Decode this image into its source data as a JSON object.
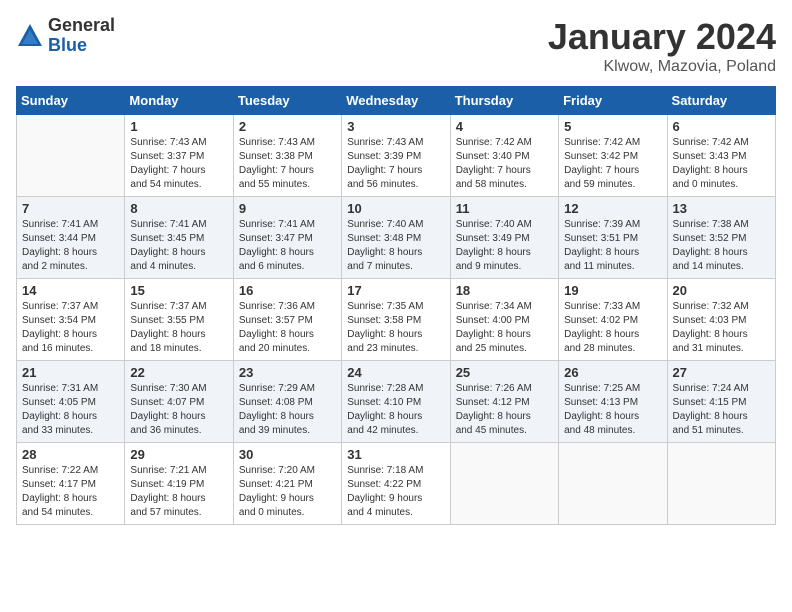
{
  "logo": {
    "general": "General",
    "blue": "Blue"
  },
  "header": {
    "title": "January 2024",
    "subtitle": "Klwow, Mazovia, Poland"
  },
  "weekdays": [
    "Sunday",
    "Monday",
    "Tuesday",
    "Wednesday",
    "Thursday",
    "Friday",
    "Saturday"
  ],
  "weeks": [
    [
      {
        "day": "",
        "info": ""
      },
      {
        "day": "1",
        "info": "Sunrise: 7:43 AM\nSunset: 3:37 PM\nDaylight: 7 hours\nand 54 minutes."
      },
      {
        "day": "2",
        "info": "Sunrise: 7:43 AM\nSunset: 3:38 PM\nDaylight: 7 hours\nand 55 minutes."
      },
      {
        "day": "3",
        "info": "Sunrise: 7:43 AM\nSunset: 3:39 PM\nDaylight: 7 hours\nand 56 minutes."
      },
      {
        "day": "4",
        "info": "Sunrise: 7:42 AM\nSunset: 3:40 PM\nDaylight: 7 hours\nand 58 minutes."
      },
      {
        "day": "5",
        "info": "Sunrise: 7:42 AM\nSunset: 3:42 PM\nDaylight: 7 hours\nand 59 minutes."
      },
      {
        "day": "6",
        "info": "Sunrise: 7:42 AM\nSunset: 3:43 PM\nDaylight: 8 hours\nand 0 minutes."
      }
    ],
    [
      {
        "day": "7",
        "info": "Sunrise: 7:41 AM\nSunset: 3:44 PM\nDaylight: 8 hours\nand 2 minutes."
      },
      {
        "day": "8",
        "info": "Sunrise: 7:41 AM\nSunset: 3:45 PM\nDaylight: 8 hours\nand 4 minutes."
      },
      {
        "day": "9",
        "info": "Sunrise: 7:41 AM\nSunset: 3:47 PM\nDaylight: 8 hours\nand 6 minutes."
      },
      {
        "day": "10",
        "info": "Sunrise: 7:40 AM\nSunset: 3:48 PM\nDaylight: 8 hours\nand 7 minutes."
      },
      {
        "day": "11",
        "info": "Sunrise: 7:40 AM\nSunset: 3:49 PM\nDaylight: 8 hours\nand 9 minutes."
      },
      {
        "day": "12",
        "info": "Sunrise: 7:39 AM\nSunset: 3:51 PM\nDaylight: 8 hours\nand 11 minutes."
      },
      {
        "day": "13",
        "info": "Sunrise: 7:38 AM\nSunset: 3:52 PM\nDaylight: 8 hours\nand 14 minutes."
      }
    ],
    [
      {
        "day": "14",
        "info": "Sunrise: 7:37 AM\nSunset: 3:54 PM\nDaylight: 8 hours\nand 16 minutes."
      },
      {
        "day": "15",
        "info": "Sunrise: 7:37 AM\nSunset: 3:55 PM\nDaylight: 8 hours\nand 18 minutes."
      },
      {
        "day": "16",
        "info": "Sunrise: 7:36 AM\nSunset: 3:57 PM\nDaylight: 8 hours\nand 20 minutes."
      },
      {
        "day": "17",
        "info": "Sunrise: 7:35 AM\nSunset: 3:58 PM\nDaylight: 8 hours\nand 23 minutes."
      },
      {
        "day": "18",
        "info": "Sunrise: 7:34 AM\nSunset: 4:00 PM\nDaylight: 8 hours\nand 25 minutes."
      },
      {
        "day": "19",
        "info": "Sunrise: 7:33 AM\nSunset: 4:02 PM\nDaylight: 8 hours\nand 28 minutes."
      },
      {
        "day": "20",
        "info": "Sunrise: 7:32 AM\nSunset: 4:03 PM\nDaylight: 8 hours\nand 31 minutes."
      }
    ],
    [
      {
        "day": "21",
        "info": "Sunrise: 7:31 AM\nSunset: 4:05 PM\nDaylight: 8 hours\nand 33 minutes."
      },
      {
        "day": "22",
        "info": "Sunrise: 7:30 AM\nSunset: 4:07 PM\nDaylight: 8 hours\nand 36 minutes."
      },
      {
        "day": "23",
        "info": "Sunrise: 7:29 AM\nSunset: 4:08 PM\nDaylight: 8 hours\nand 39 minutes."
      },
      {
        "day": "24",
        "info": "Sunrise: 7:28 AM\nSunset: 4:10 PM\nDaylight: 8 hours\nand 42 minutes."
      },
      {
        "day": "25",
        "info": "Sunrise: 7:26 AM\nSunset: 4:12 PM\nDaylight: 8 hours\nand 45 minutes."
      },
      {
        "day": "26",
        "info": "Sunrise: 7:25 AM\nSunset: 4:13 PM\nDaylight: 8 hours\nand 48 minutes."
      },
      {
        "day": "27",
        "info": "Sunrise: 7:24 AM\nSunset: 4:15 PM\nDaylight: 8 hours\nand 51 minutes."
      }
    ],
    [
      {
        "day": "28",
        "info": "Sunrise: 7:22 AM\nSunset: 4:17 PM\nDaylight: 8 hours\nand 54 minutes."
      },
      {
        "day": "29",
        "info": "Sunrise: 7:21 AM\nSunset: 4:19 PM\nDaylight: 8 hours\nand 57 minutes."
      },
      {
        "day": "30",
        "info": "Sunrise: 7:20 AM\nSunset: 4:21 PM\nDaylight: 9 hours\nand 0 minutes."
      },
      {
        "day": "31",
        "info": "Sunrise: 7:18 AM\nSunset: 4:22 PM\nDaylight: 9 hours\nand 4 minutes."
      },
      {
        "day": "",
        "info": ""
      },
      {
        "day": "",
        "info": ""
      },
      {
        "day": "",
        "info": ""
      }
    ]
  ]
}
